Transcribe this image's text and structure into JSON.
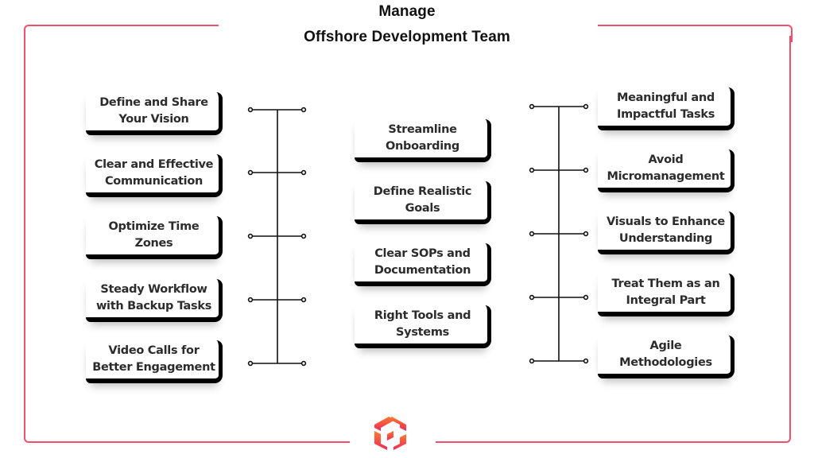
{
  "title": {
    "line1": "Manage",
    "line2": "Offshore Development Team"
  },
  "colors": {
    "frame": "#f0506e",
    "card_border": "#000000",
    "text": "#2c2c2c",
    "logo_gradient_top": "#ff7a2e",
    "logo_gradient_bottom": "#f0285a"
  },
  "left_column": {
    "items": [
      {
        "label": "Define and Share\nYour Vision"
      },
      {
        "label": "Clear and Effective\nCommunication"
      },
      {
        "label": "Optimize Time\nZones"
      },
      {
        "label": "Steady Workflow\nwith Backup Tasks"
      },
      {
        "label": "Video Calls for\nBetter Engagement"
      }
    ]
  },
  "middle_column": {
    "items": [
      {
        "label": "Streamline\nOnboarding"
      },
      {
        "label": "Define Realistic\nGoals"
      },
      {
        "label": "Clear SOPs and\nDocumentation"
      },
      {
        "label": "Right Tools and\nSystems"
      }
    ]
  },
  "right_column": {
    "items": [
      {
        "label": "Meaningful and\nImpactful Tasks"
      },
      {
        "label": "Avoid\nMicromanagement"
      },
      {
        "label": "Visuals to Enhance\nUnderstanding"
      },
      {
        "label": "Treat Them as an\nIntegral Part"
      },
      {
        "label": "Agile\nMethodologies"
      }
    ]
  },
  "logo": {
    "icon": "cube-logo-icon"
  }
}
